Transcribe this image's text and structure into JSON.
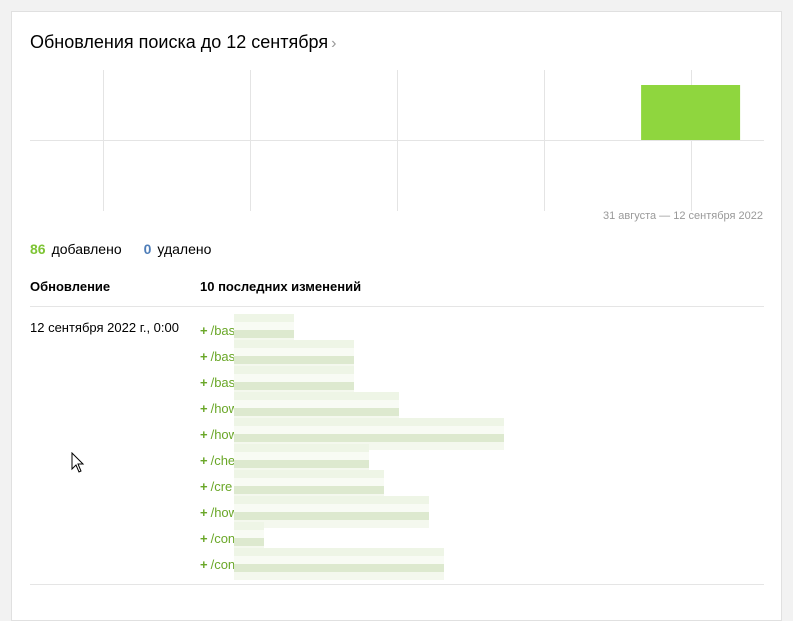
{
  "header": {
    "title": "Обновления поиска до 12 сентября",
    "chevron": "›"
  },
  "chart_data": {
    "type": "bar",
    "categories": [
      "",
      "",
      "",
      "",
      ""
    ],
    "values": [
      0,
      0,
      0,
      0,
      86
    ],
    "title": "",
    "xlabel": "",
    "ylabel": "",
    "grid": true,
    "colors": {
      "added": "#8fd63e",
      "grid": "#e4e4e4"
    }
  },
  "period": "31 августа — 12 сентября 2022",
  "stats": {
    "added_count": "86",
    "added_label": "добавлено",
    "removed_count": "0",
    "removed_label": "удалено"
  },
  "table": {
    "col_update": "Обновление",
    "col_changes": "10 последних изменений",
    "row": {
      "date": "12 сентября 2022 г., 0:00",
      "changes": [
        {
          "plus": "+",
          "path": "/bas"
        },
        {
          "plus": "+",
          "path": "/bas"
        },
        {
          "plus": "+",
          "path": "/bas"
        },
        {
          "plus": "+",
          "path": "/how"
        },
        {
          "plus": "+",
          "path": "/how"
        },
        {
          "plus": "+",
          "path": "/che"
        },
        {
          "plus": "+",
          "path": "/cre"
        },
        {
          "plus": "+",
          "path": "/how"
        },
        {
          "plus": "+",
          "path": "/con"
        },
        {
          "plus": "+",
          "path": "/con"
        }
      ]
    }
  },
  "icons": {
    "cursor": "mouse-pointer-icon"
  }
}
